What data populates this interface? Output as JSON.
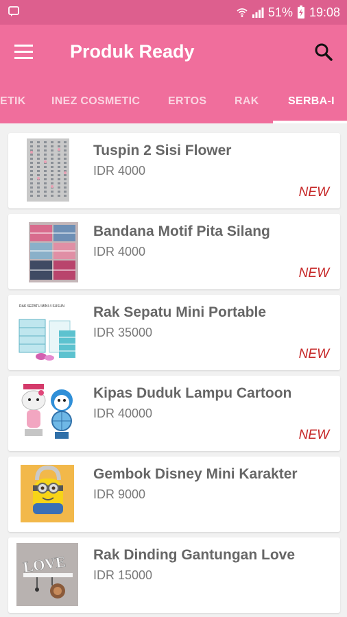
{
  "status_bar": {
    "battery": "51%",
    "time": "19:08"
  },
  "app_bar": {
    "title": "Produk Ready",
    "menu_icon": "hamburger-menu-icon",
    "search_icon": "search-icon"
  },
  "tabs": [
    {
      "label": "ETIK",
      "active": false
    },
    {
      "label": "INEZ COSMETIC",
      "active": false
    },
    {
      "label": "ERTOS",
      "active": false
    },
    {
      "label": "RAK",
      "active": false
    },
    {
      "label": "SERBA-I",
      "active": true
    }
  ],
  "products": [
    {
      "name": "Tuspin 2 Sisi Flower",
      "price": "IDR 4000",
      "badge": "NEW"
    },
    {
      "name": "Bandana Motif Pita Silang",
      "price": "IDR 4000",
      "badge": "NEW"
    },
    {
      "name": "Rak Sepatu Mini Portable",
      "price": "IDR 35000",
      "badge": "NEW"
    },
    {
      "name": "Kipas Duduk Lampu Cartoon",
      "price": "IDR 40000",
      "badge": "NEW"
    },
    {
      "name": "Gembok Disney Mini Karakter",
      "price": "IDR 9000",
      "badge": ""
    },
    {
      "name": "Rak Dinding Gantungan Love",
      "price": "IDR 15000",
      "badge": ""
    }
  ],
  "thumb_labels": {
    "rak_sepatu": "RAK SEPATU MINI 4 SUSUN",
    "love": "LOVE"
  },
  "colors": {
    "primary": "#f06e9c",
    "status_bar": "#dd5f8e",
    "badge": "#c62828"
  }
}
